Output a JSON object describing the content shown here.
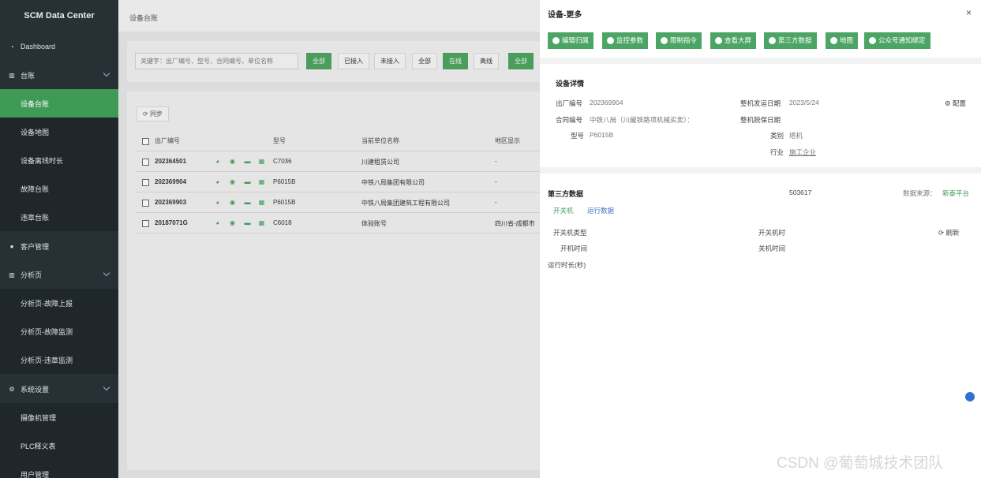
{
  "sidebar": {
    "brand": "SCM Data Center",
    "items": [
      {
        "label": "Dashboard",
        "icon": "gauge-icon"
      },
      {
        "label": "台账",
        "icon": "bar-chart-icon"
      },
      {
        "label": "设备台账"
      },
      {
        "label": "设备地图"
      },
      {
        "label": "设备离线时长"
      },
      {
        "label": "故障台账"
      },
      {
        "label": "违章台账"
      },
      {
        "label": "客户管理",
        "icon": "user-icon"
      },
      {
        "label": "分析页",
        "icon": "bar-chart-icon"
      },
      {
        "label": "分析页-故障上报"
      },
      {
        "label": "分析页-故障监测"
      },
      {
        "label": "分析页-违章监测"
      },
      {
        "label": "系统设置",
        "icon": "gear-icon"
      },
      {
        "label": "摄像机管理"
      },
      {
        "label": "PLC释义表"
      },
      {
        "label": "用户管理"
      }
    ]
  },
  "main": {
    "breadcrumb": "设备台账",
    "search": {
      "placeholder": "关键字：出厂编号、型号、合同编号、单位名称"
    },
    "filters": [
      "全部",
      "已接入",
      "未接入",
      "全部",
      "在线",
      "离线",
      "全部"
    ],
    "sync_label": "同步",
    "columns": [
      "出厂编号",
      "型号",
      "当前单位名称",
      "地区显示"
    ],
    "rows": [
      {
        "serial": "202364501",
        "model": "C7036",
        "unit": "川建租赁公司",
        "region": "-"
      },
      {
        "serial": "202369904",
        "model": "P6015B",
        "unit": "中铁八局集团有限公司",
        "region": "-"
      },
      {
        "serial": "202369903",
        "model": "P6015B",
        "unit": "中铁八局集团建筑工程有限公司",
        "region": "-"
      },
      {
        "serial": "20187071G",
        "model": "C6018",
        "unit": "体验账号",
        "region": "四川省-成都市"
      }
    ]
  },
  "drawer": {
    "title": "设备-更多",
    "close": "×",
    "actions": [
      "编辑归属",
      "监控参数",
      "限制指令",
      "查看大屏",
      "第三方数据",
      "地图",
      "公众号通知绑定"
    ],
    "detail": {
      "section_title": "设备详情",
      "serial_label": "出厂编号",
      "serial_value": "202369904",
      "ship_date_label": "整机发运日期",
      "ship_date_value": "2023/5/24",
      "config_label": "配置",
      "contract_label": "合同编号",
      "contract_value": "中铁八局（川藏铁路项机械买卖）：",
      "warranty_label": "整机脱保日期",
      "model_label": "型号",
      "model_value": "P6015B",
      "category_label": "类别",
      "category_value": "塔机",
      "industry_label": "行业",
      "industry_value": "施工企业"
    },
    "third_party": {
      "section_title": "第三方数据",
      "id_value": "503617",
      "source_label": "数据来源：",
      "source_value": "新泰平台",
      "tab_power": "开关机",
      "tab_run": "运行数据",
      "power_type_label": "开关机类型",
      "power_time_label": "开关机时",
      "refresh_label": "刷新",
      "on_time_label": "开机时间",
      "off_time_label": "关机时间",
      "run_duration_label": "运行时长(秒)"
    }
  },
  "watermark": "CSDN @葡萄城技术团队"
}
